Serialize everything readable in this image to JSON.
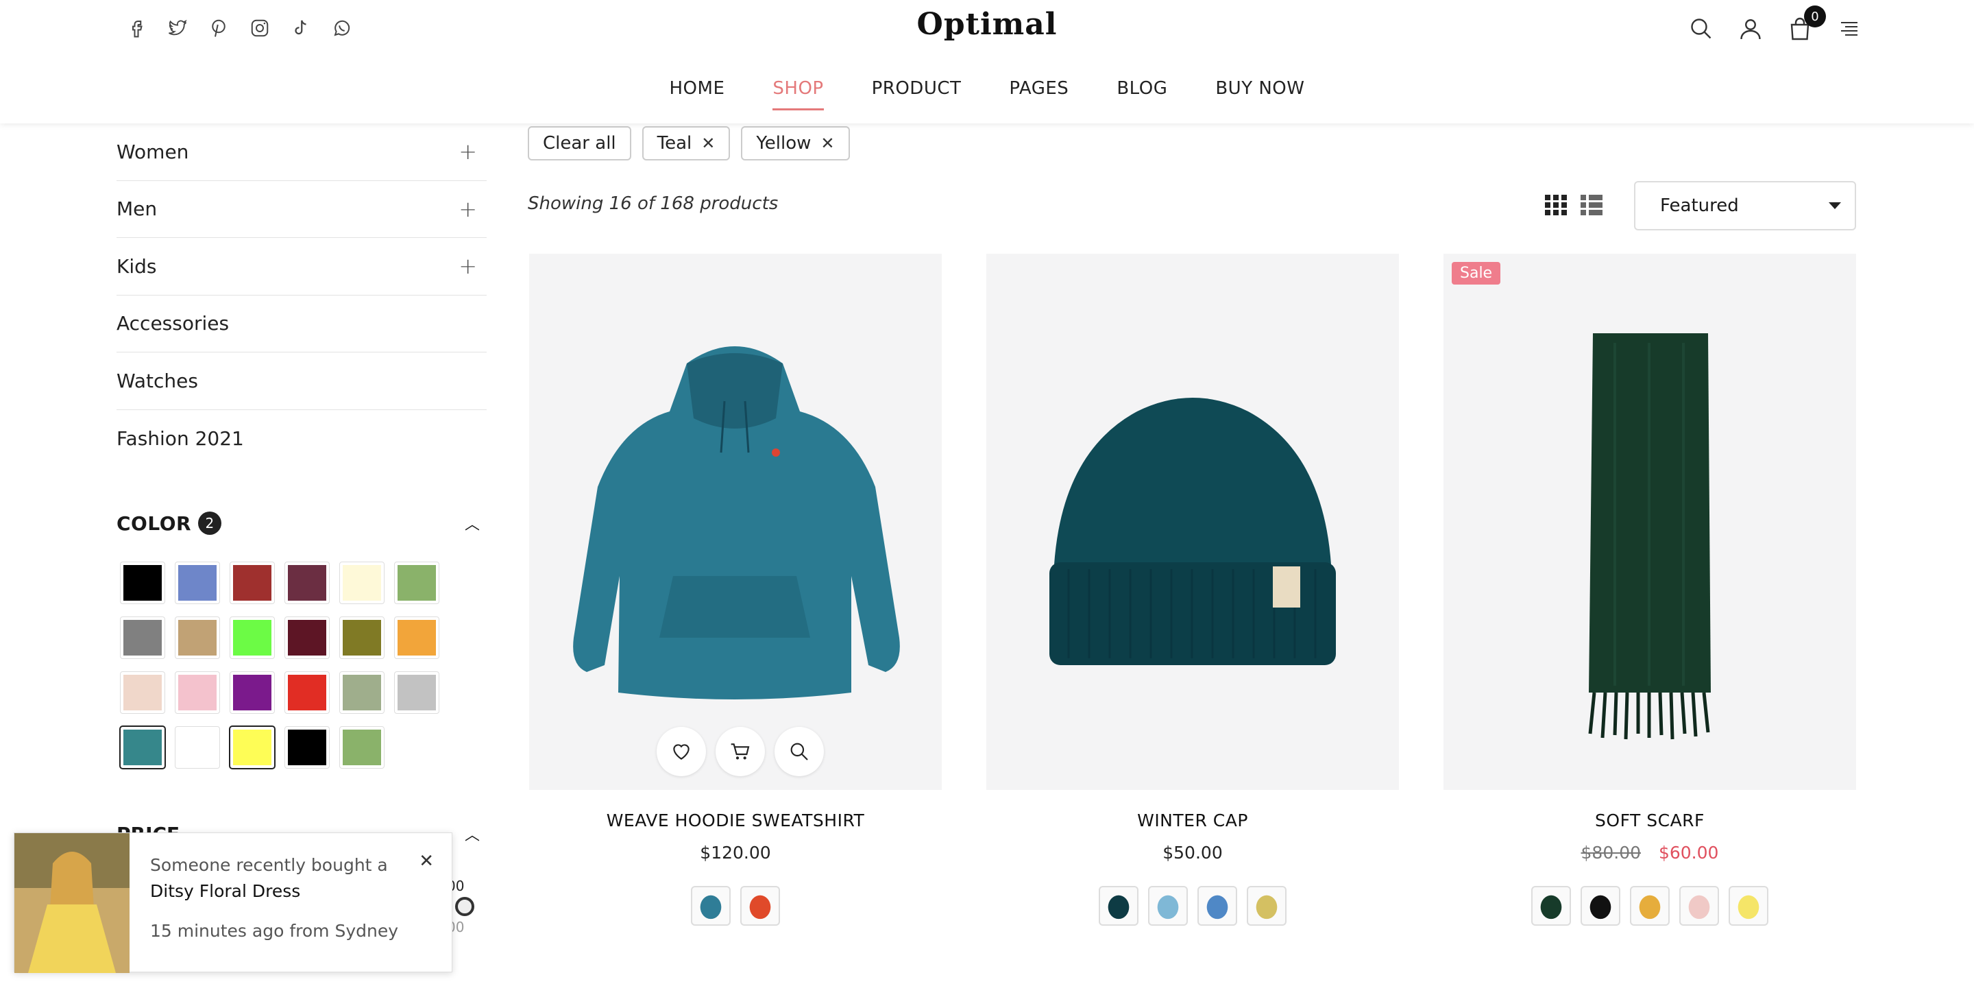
{
  "header": {
    "brand": "Optimal",
    "socials": [
      "facebook-icon",
      "twitter-icon",
      "pinterest-icon",
      "instagram-icon",
      "tiktok-icon",
      "whatsapp-icon"
    ],
    "cart_count": "0",
    "nav": [
      "HOME",
      "SHOP",
      "PRODUCT",
      "PAGES",
      "BLOG",
      "BUY NOW"
    ],
    "active_nav": "SHOP"
  },
  "sidebar": {
    "categories": [
      {
        "label": "Women",
        "expandable": "+"
      },
      {
        "label": "Men",
        "expandable": "+"
      },
      {
        "label": "Kids",
        "expandable": "+"
      },
      {
        "label": "Accessories",
        "expandable": ""
      },
      {
        "label": "Watches",
        "expandable": ""
      },
      {
        "label": "Fashion 2021",
        "expandable": ""
      }
    ],
    "color_filter": {
      "title": "COLOR",
      "count": "2",
      "swatches": [
        {
          "color": "#000000",
          "selected": false
        },
        {
          "color": "#6e86c9",
          "selected": false
        },
        {
          "color": "#9f302e",
          "selected": false
        },
        {
          "color": "#6b2e42",
          "selected": false
        },
        {
          "color": "#fef9d8",
          "selected": false
        },
        {
          "color": "#8ab26a",
          "selected": false
        },
        {
          "color": "#808080",
          "selected": false
        },
        {
          "color": "#c1a275",
          "selected": false
        },
        {
          "color": "#6cfb45",
          "selected": false
        },
        {
          "color": "#5d1525",
          "selected": false
        },
        {
          "color": "#807a25",
          "selected": false
        },
        {
          "color": "#f2a53a",
          "selected": false
        },
        {
          "color": "#f0d7ca",
          "selected": false
        },
        {
          "color": "#f4c2cd",
          "selected": false
        },
        {
          "color": "#7b1a8c",
          "selected": false
        },
        {
          "color": "#e12d24",
          "selected": false
        },
        {
          "color": "#9fae8c",
          "selected": false
        },
        {
          "color": "#c2c2c2",
          "selected": false
        },
        {
          "color": "#36878b",
          "selected": true
        },
        {
          "color": "#ffffff",
          "selected": false
        },
        {
          "color": "#fefd56",
          "selected": true
        },
        {
          "color": "#000000",
          "selected": false
        },
        {
          "color": "#8ab26a",
          "selected": false
        }
      ]
    },
    "price_filter": {
      "title": "PRICE",
      "max_label": "00",
      "sub_label": "00"
    }
  },
  "toolbar": {
    "chips": [
      {
        "label": "Clear all",
        "removable": false
      },
      {
        "label": "Teal",
        "removable": true
      },
      {
        "label": "Yellow",
        "removable": true
      }
    ],
    "remove_glyph": "✕",
    "showing": "Showing 16 of 168 products",
    "sort": "Featured"
  },
  "products": [
    {
      "name": "WEAVE HOODIE SWEATSHIRT",
      "price": "$120.00",
      "old_price": "",
      "sale": "",
      "variants": [
        "#2f7d97",
        "#e04a2a"
      ]
    },
    {
      "name": "WINTER CAP",
      "price": "$50.00",
      "old_price": "",
      "sale": "",
      "variants": [
        "#0e3b44",
        "#7fb8d6",
        "#4f88c6",
        "#d4c062"
      ]
    },
    {
      "name": "SOFT SCARF",
      "price": "$60.00",
      "old_price": "$80.00",
      "sale": "Sale",
      "variants": [
        "#173b2a",
        "#111111",
        "#e6ad3c",
        "#f0c9c6",
        "#f5e568"
      ]
    }
  ],
  "popup": {
    "line1": "Someone recently bought a",
    "product": "Ditsy Floral Dress",
    "time": "15 minutes ago from Sydney",
    "close": "✕"
  }
}
